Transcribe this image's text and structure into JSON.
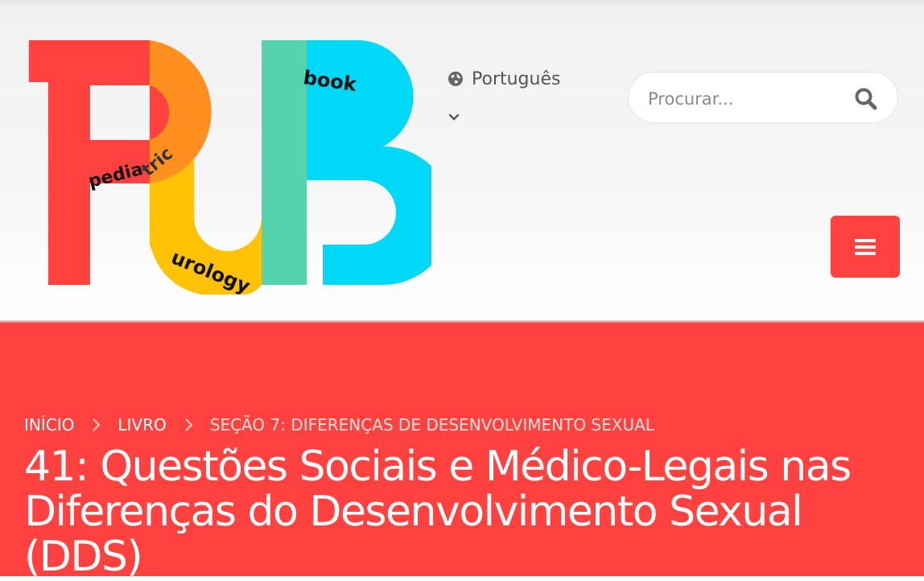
{
  "logo": {
    "wordmark_left": "pedia",
    "wordmark_tric": "tric",
    "wordmark_bottom": "urology",
    "wordmark_top": "book",
    "colors": {
      "red": "#ff423f",
      "orange": "#ff8f1f",
      "yellow": "#ffc205",
      "green": "#54d3ad",
      "blue": "#00d8f7"
    }
  },
  "header": {
    "language_label": "Português",
    "language_icon": "globe-icon",
    "search_placeholder": "Procurar...",
    "search_icon": "search-icon",
    "menu_icon": "hamburger-icon"
  },
  "breadcrumb": {
    "items": [
      "INÍCIO",
      "LIVRO"
    ],
    "current": "SEÇÃO 7: DIFERENÇAS DE DESENVOLVIMENTO SEXUAL"
  },
  "page": {
    "title": "41: Questões Sociais e Médico-Legais nas Diferenças do Desenvolvimento Sexual (DDS)"
  },
  "colors": {
    "accent": "#ff423f",
    "header_bg": "#f3f3f3",
    "text_muted": "#555555"
  }
}
